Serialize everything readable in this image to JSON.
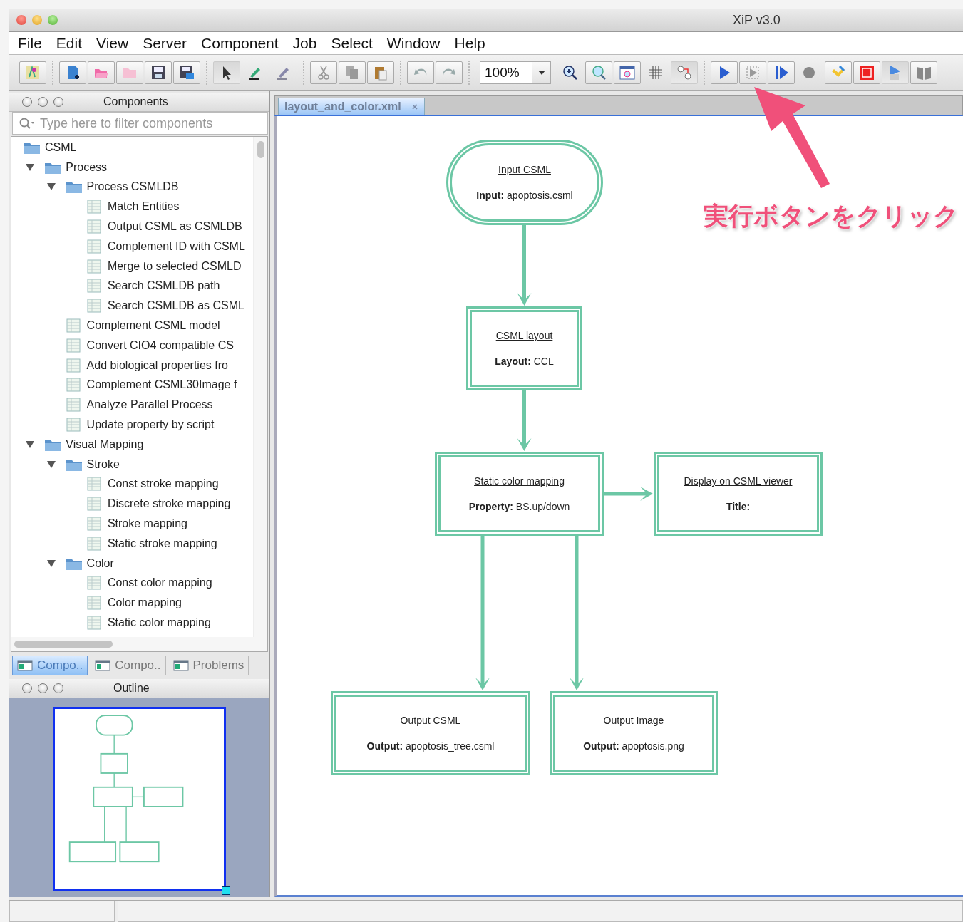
{
  "window": {
    "title": "XiP v3.0"
  },
  "menu": [
    "File",
    "Edit",
    "View",
    "Server",
    "Component",
    "Job",
    "Select",
    "Window",
    "Help"
  ],
  "toolbar": {
    "zoom_value": "100%"
  },
  "components_panel": {
    "title": "Components",
    "search": {
      "placeholder": "Type here to filter components"
    },
    "tree": [
      {
        "label": "CSML",
        "kind": "folder",
        "children": [
          {
            "label": "Process",
            "kind": "folder",
            "expanded": true,
            "children": [
              {
                "label": "Process CSMLDB",
                "kind": "folder",
                "expanded": true,
                "children": [
                  {
                    "label": "Match Entities",
                    "kind": "component"
                  },
                  {
                    "label": "Output CSML as CSMLDB",
                    "kind": "component"
                  },
                  {
                    "label": "Complement ID with CSML",
                    "kind": "component"
                  },
                  {
                    "label": "Merge to selected CSMLD",
                    "kind": "component"
                  },
                  {
                    "label": "Search CSMLDB path",
                    "kind": "component"
                  },
                  {
                    "label": "Search CSMLDB as CSML",
                    "kind": "component"
                  }
                ]
              },
              {
                "label": "Complement CSML model",
                "kind": "component"
              },
              {
                "label": "Convert CIO4 compatible CS",
                "kind": "component"
              },
              {
                "label": "Add biological properties fro",
                "kind": "component"
              },
              {
                "label": "Complement CSML30Image f",
                "kind": "component"
              },
              {
                "label": "Analyze Parallel Process",
                "kind": "component"
              },
              {
                "label": "Update property by script",
                "kind": "component"
              }
            ]
          },
          {
            "label": "Visual Mapping",
            "kind": "folder",
            "expanded": true,
            "children": [
              {
                "label": "Stroke",
                "kind": "folder",
                "expanded": true,
                "children": [
                  {
                    "label": "Const stroke mapping",
                    "kind": "component"
                  },
                  {
                    "label": "Discrete stroke mapping",
                    "kind": "component"
                  },
                  {
                    "label": "Stroke mapping",
                    "kind": "component"
                  },
                  {
                    "label": "Static stroke mapping",
                    "kind": "component"
                  }
                ]
              },
              {
                "label": "Color",
                "kind": "folder",
                "expanded": true,
                "children": [
                  {
                    "label": "Const color mapping",
                    "kind": "component"
                  },
                  {
                    "label": "Color mapping",
                    "kind": "component"
                  },
                  {
                    "label": "Static color mapping",
                    "kind": "component"
                  }
                ]
              }
            ]
          }
        ]
      }
    ]
  },
  "panel_tabs": [
    {
      "label": "Compo..",
      "selected": true
    },
    {
      "label": "Compo..",
      "selected": false
    },
    {
      "label": "Problems",
      "selected": false
    }
  ],
  "outline_panel": {
    "title": "Outline"
  },
  "editor": {
    "tabs": [
      {
        "label": "layout_and_color.xml",
        "selected": true
      }
    ],
    "nodes": [
      {
        "kind": "terminal",
        "title": "Input CSML",
        "field": {
          "label": "Input:",
          "value": "apoptosis.csml"
        }
      },
      {
        "kind": "process",
        "title": "CSML layout",
        "field": {
          "label": "Layout:",
          "value": "CCL"
        }
      },
      {
        "kind": "process",
        "title": "Static color mapping",
        "field": {
          "label": "Property:",
          "value": "BS.up/down"
        }
      },
      {
        "kind": "process",
        "title": "Display on CSML viewer",
        "field": {
          "label": "Title:"
        }
      },
      {
        "kind": "process",
        "title": "Output CSML",
        "field": {
          "label": "Output:",
          "value": "apoptosis_tree.csml"
        }
      },
      {
        "kind": "process",
        "title": "Output Image",
        "field": {
          "label": "Output:",
          "value": "apoptosis.png"
        }
      }
    ]
  },
  "annotation": {
    "text": "実行ボタンをクリック"
  }
}
